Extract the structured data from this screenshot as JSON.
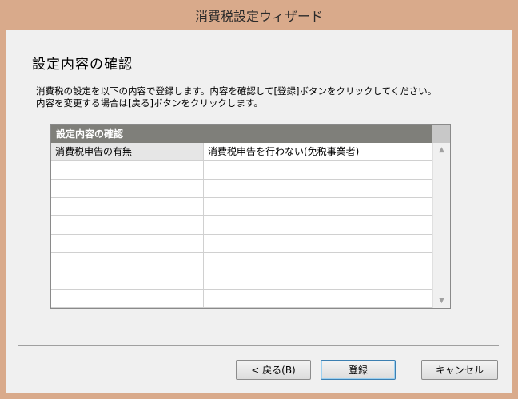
{
  "window": {
    "title": "消費税設定ウィザード"
  },
  "page": {
    "heading": "設定内容の確認",
    "description_lines": [
      "消費税の設定を以下の内容で登録します。内容を確認して[登録]ボタンをクリックしてください。",
      "内容を変更する場合は[戻る]ボタンをクリックします。"
    ]
  },
  "grid": {
    "header": "設定内容の確認",
    "rows": [
      {
        "label": "消費税申告の有無",
        "value": "消費税申告を行わない(免税事業者)"
      },
      {
        "label": "",
        "value": ""
      },
      {
        "label": "",
        "value": ""
      },
      {
        "label": "",
        "value": ""
      },
      {
        "label": "",
        "value": ""
      },
      {
        "label": "",
        "value": ""
      },
      {
        "label": "",
        "value": ""
      },
      {
        "label": "",
        "value": ""
      },
      {
        "label": "",
        "value": ""
      }
    ],
    "scroll_up_icon": "▲",
    "scroll_down_icon": "▼"
  },
  "buttons": {
    "back": "< 戻る(B)",
    "register": "登録",
    "cancel": "キャンセル"
  }
}
